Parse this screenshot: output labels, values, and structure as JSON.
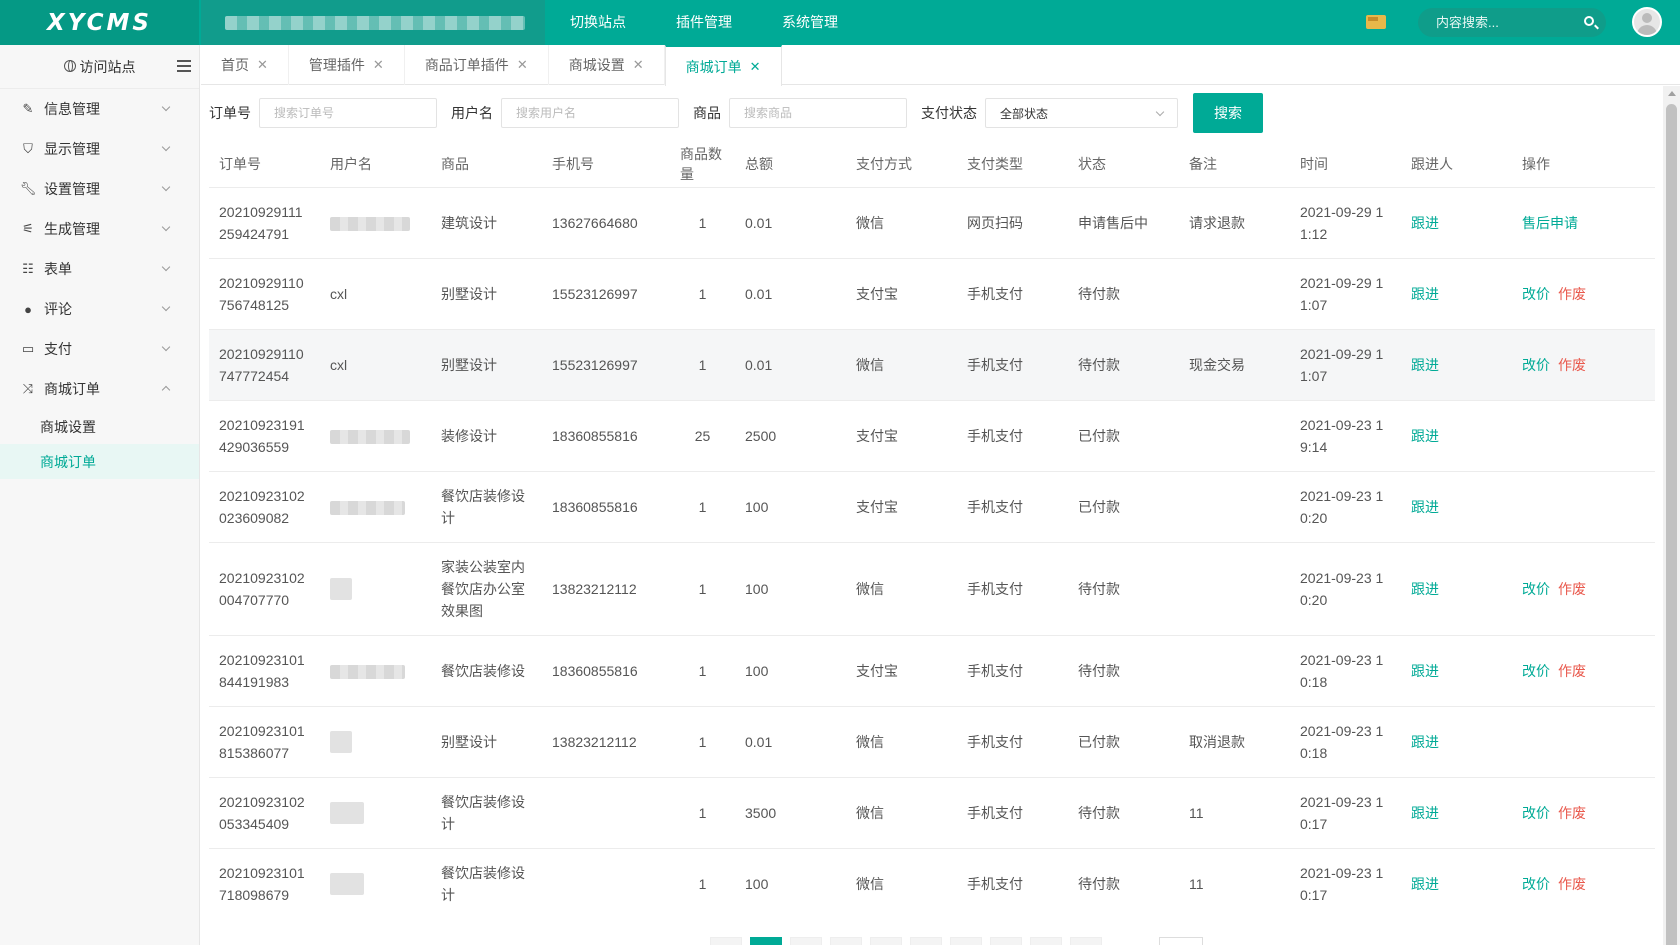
{
  "brand": {
    "logo": "XYCMS"
  },
  "topnav": {
    "items": [
      "切换站点",
      "插件管理",
      "系统管理"
    ]
  },
  "top_search": {
    "placeholder": "内容搜索..."
  },
  "sidebar": {
    "visit_label": "访问站点",
    "items": [
      {
        "label": "信息管理",
        "icon": "edit-icon"
      },
      {
        "label": "显示管理",
        "icon": "shirt-icon"
      },
      {
        "label": "设置管理",
        "icon": "wrench-icon"
      },
      {
        "label": "生成管理",
        "icon": "magic-wand-icon"
      },
      {
        "label": "表单",
        "icon": "list-icon"
      },
      {
        "label": "评论",
        "icon": "comment-icon"
      },
      {
        "label": "支付",
        "icon": "credit-card-icon"
      },
      {
        "label": "商城订单",
        "icon": "shuffle-icon"
      }
    ],
    "sub_items": [
      "商城设置",
      "商城订单"
    ]
  },
  "tabs": [
    {
      "label": "首页"
    },
    {
      "label": "管理插件"
    },
    {
      "label": "商品订单插件"
    },
    {
      "label": "商城设置"
    },
    {
      "label": "商城订单"
    }
  ],
  "filters": {
    "order_label": "订单号",
    "order_placeholder": "搜索订单号",
    "user_label": "用户名",
    "user_placeholder": "搜索用户名",
    "product_label": "商品",
    "product_placeholder": "搜索商品",
    "status_label": "支付状态",
    "status_value": "全部状态",
    "search_button": "搜索"
  },
  "table": {
    "headers": [
      "订单号",
      "用户名",
      "商品",
      "手机号",
      "商品数量",
      "总额",
      "支付方式",
      "支付类型",
      "状态",
      "备注",
      "时间",
      "跟进人",
      "操作"
    ],
    "rows": [
      {
        "order": "20210929111\n259424791",
        "user": "",
        "product": "建筑设计",
        "phone": "13627664680",
        "qty": "1",
        "total": "0.01",
        "pay_method": "微信",
        "pay_type": "网页扫码",
        "status": "申请售后中",
        "note": "请求退款",
        "time": "2021-09-29 1\n1:12",
        "follow": "跟进",
        "action1": "售后申请",
        "action2": ""
      },
      {
        "order": "20210929110\n756748125",
        "user": "cxl",
        "product": "别墅设计",
        "phone": "15523126997",
        "qty": "1",
        "total": "0.01",
        "pay_method": "支付宝",
        "pay_type": "手机支付",
        "status": "待付款",
        "note": "",
        "time": "2021-09-29 1\n1:07",
        "follow": "跟进",
        "action1": "改价",
        "action2": "作废"
      },
      {
        "order": "20210929110\n747772454",
        "user": "cxl",
        "product": "别墅设计",
        "phone": "15523126997",
        "qty": "1",
        "total": "0.01",
        "pay_method": "微信",
        "pay_type": "手机支付",
        "status": "待付款",
        "note": "现金交易",
        "time": "2021-09-29 1\n1:07",
        "follow": "跟进",
        "action1": "改价",
        "action2": "作废"
      },
      {
        "order": "20210923191\n429036559",
        "user": "",
        "product": "装修设计",
        "phone": "18360855816",
        "qty": "25",
        "total": "2500",
        "pay_method": "支付宝",
        "pay_type": "手机支付",
        "status": "已付款",
        "note": "",
        "time": "2021-09-23 1\n9:14",
        "follow": "跟进",
        "action1": "",
        "action2": ""
      },
      {
        "order": "20210923102\n023609082",
        "user": "",
        "product": "餐饮店装修设\n计",
        "phone": "18360855816",
        "qty": "1",
        "total": "100",
        "pay_method": "支付宝",
        "pay_type": "手机支付",
        "status": "已付款",
        "note": "",
        "time": "2021-09-23 1\n0:20",
        "follow": "跟进",
        "action1": "",
        "action2": ""
      },
      {
        "order": "20210923102\n004707770",
        "user": "",
        "product": "家装公装室内\n餐饮店办公室\n效果图",
        "phone": "13823212112",
        "qty": "1",
        "total": "100",
        "pay_method": "微信",
        "pay_type": "手机支付",
        "status": "待付款",
        "note": "",
        "time": "2021-09-23 1\n0:20",
        "follow": "跟进",
        "action1": "改价",
        "action2": "作废"
      },
      {
        "order": "20210923101\n844191983",
        "user": "",
        "product": "餐饮店装修设\n",
        "phone": "18360855816",
        "qty": "1",
        "total": "100",
        "pay_method": "支付宝",
        "pay_type": "手机支付",
        "status": "待付款",
        "note": "",
        "time": "2021-09-23 1\n0:18",
        "follow": "跟进",
        "action1": "改价",
        "action2": "作废"
      },
      {
        "order": "20210923101\n815386077",
        "user": "",
        "product": "别墅设计",
        "phone": "13823212112",
        "qty": "1",
        "total": "0.01",
        "pay_method": "微信",
        "pay_type": "手机支付",
        "status": "已付款",
        "note": "取消退款",
        "time": "2021-09-23 1\n0:18",
        "follow": "跟进",
        "action1": "",
        "action2": ""
      },
      {
        "order": "20210923102\n053345409",
        "user": "",
        "product": "餐饮店装修设\n计",
        "phone": "",
        "qty": "1",
        "total": "3500",
        "pay_method": "微信",
        "pay_type": "手机支付",
        "status": "待付款",
        "note": "11",
        "time": "2021-09-23 1\n0:17",
        "follow": "跟进",
        "action1": "改价",
        "action2": "作废"
      },
      {
        "order": "20210923101\n718098679",
        "user": "",
        "product": "餐饮店装修设\n计",
        "phone": "",
        "qty": "1",
        "total": "100",
        "pay_method": "微信",
        "pay_type": "手机支付",
        "status": "待付款",
        "note": "11",
        "time": "2021-09-23 1\n0:17",
        "follow": "跟进",
        "action1": "改价",
        "action2": "作废"
      }
    ]
  },
  "colors": {
    "brand": "#00aa96",
    "danger": "#e95a4e"
  }
}
